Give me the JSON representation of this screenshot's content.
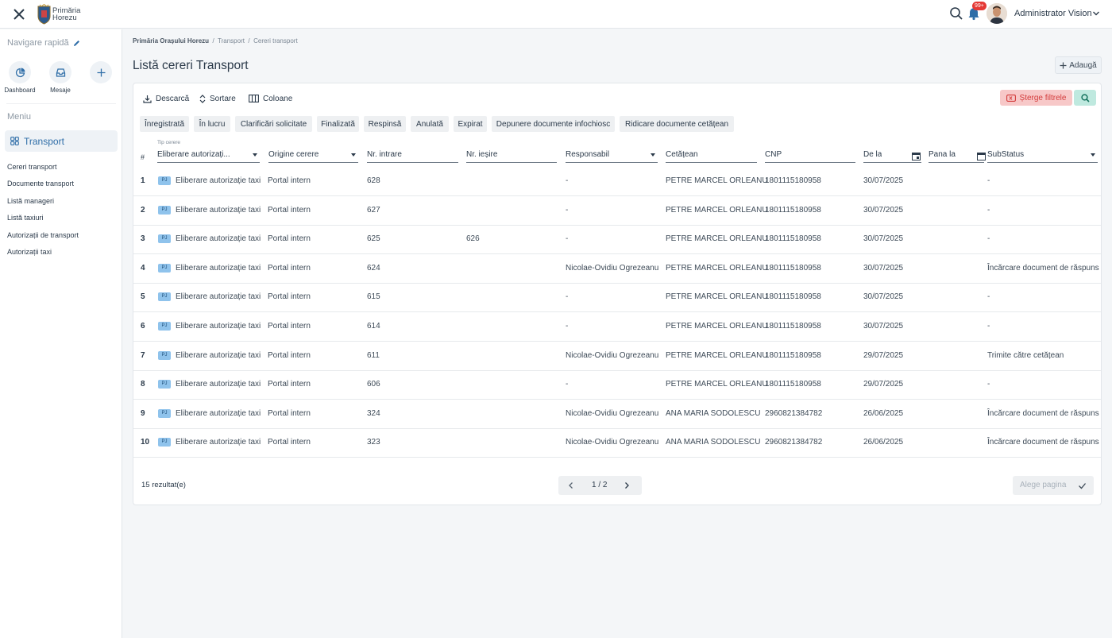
{
  "header": {
    "logo_text_line1": "Primăria",
    "logo_text_line2": "Horezu",
    "notification_badge": "99+",
    "user_name": "Administrator Vision"
  },
  "sidebar": {
    "quick_nav_title": "Navigare rapidă",
    "quick_items": [
      {
        "label": "Dashboard",
        "icon": "pie-chart-icon"
      },
      {
        "label": "Mesaje",
        "icon": "inbox-icon"
      },
      {
        "label": "",
        "icon": "plus-icon"
      }
    ],
    "menu_title": "Meniu",
    "active_item": "Transport",
    "sub_items": [
      "Cereri transport",
      "Documente transport",
      "Listă manageri",
      "Listă taxiuri",
      "Autorizații de transport",
      "Autorizații taxi"
    ]
  },
  "breadcrumb": {
    "root": "Primăria Orașului Horezu",
    "section": "Transport",
    "current": "Cereri transport"
  },
  "page": {
    "title": "Listă cereri Transport",
    "add_label": "Adaugă"
  },
  "toolbar": {
    "download": "Descarcă",
    "sort": "Sortare",
    "columns": "Coloane",
    "clear_filters": "Șterge filtrele"
  },
  "status_chips": [
    "Înregistrată",
    "În lucru",
    "Clarificări solicitate",
    "Finalizată",
    "Respinsă",
    "Anulată",
    "Expirat",
    "Depunere documente infochiosc",
    "Ridicare documente cetățean"
  ],
  "filters": {
    "hash": "#",
    "tip_cerere_small": "Tip cerere",
    "tip_cerere": "Eliberare autorizați...",
    "origine": "Origine cerere",
    "nr_intrare": "Nr. intrare",
    "nr_iesire": "Nr. ieșire",
    "responsabil": "Responsabil",
    "cetatean": "Cetățean",
    "cnp": "CNP",
    "de_la": "De la",
    "pana_la": "Pana la",
    "substatus": "SubStatus"
  },
  "rows": [
    {
      "num": "1",
      "badge": "PJ",
      "tip": "Eliberare autorizație taxi",
      "origine": "Portal intern",
      "intrare": "628",
      "iesire": "",
      "responsabil": "-",
      "cetatean": "PETRE MARCEL ORLEANU",
      "cnp": "1801115180958",
      "data": "30/07/2025",
      "substatus": "-"
    },
    {
      "num": "2",
      "badge": "PJ",
      "tip": "Eliberare autorizație taxi",
      "origine": "Portal intern",
      "intrare": "627",
      "iesire": "",
      "responsabil": "-",
      "cetatean": "PETRE MARCEL ORLEANU",
      "cnp": "1801115180958",
      "data": "30/07/2025",
      "substatus": "-"
    },
    {
      "num": "3",
      "badge": "PJ",
      "tip": "Eliberare autorizație taxi",
      "origine": "Portal intern",
      "intrare": "625",
      "iesire": "626",
      "responsabil": "-",
      "cetatean": "PETRE MARCEL ORLEANU",
      "cnp": "1801115180958",
      "data": "30/07/2025",
      "substatus": "-"
    },
    {
      "num": "4",
      "badge": "PJ",
      "tip": "Eliberare autorizație taxi",
      "origine": "Portal intern",
      "intrare": "624",
      "iesire": "",
      "responsabil": "Nicolae-Ovidiu Ogrezeanu",
      "cetatean": "PETRE MARCEL ORLEANU",
      "cnp": "1801115180958",
      "data": "30/07/2025",
      "substatus": "Încărcare document de răspuns"
    },
    {
      "num": "5",
      "badge": "PJ",
      "tip": "Eliberare autorizație taxi",
      "origine": "Portal intern",
      "intrare": "615",
      "iesire": "",
      "responsabil": "-",
      "cetatean": "PETRE MARCEL ORLEANU",
      "cnp": "1801115180958",
      "data": "30/07/2025",
      "substatus": "-"
    },
    {
      "num": "6",
      "badge": "PJ",
      "tip": "Eliberare autorizație taxi",
      "origine": "Portal intern",
      "intrare": "614",
      "iesire": "",
      "responsabil": "-",
      "cetatean": "PETRE MARCEL ORLEANU",
      "cnp": "1801115180958",
      "data": "30/07/2025",
      "substatus": "-"
    },
    {
      "num": "7",
      "badge": "PJ",
      "tip": "Eliberare autorizație taxi",
      "origine": "Portal intern",
      "intrare": "611",
      "iesire": "",
      "responsabil": "Nicolae-Ovidiu Ogrezeanu",
      "cetatean": "PETRE MARCEL ORLEANU",
      "cnp": "1801115180958",
      "data": "29/07/2025",
      "substatus": "Trimite către cetățean"
    },
    {
      "num": "8",
      "badge": "PJ",
      "tip": "Eliberare autorizație taxi",
      "origine": "Portal intern",
      "intrare": "606",
      "iesire": "",
      "responsabil": "-",
      "cetatean": "PETRE MARCEL ORLEANU",
      "cnp": "1801115180958",
      "data": "29/07/2025",
      "substatus": "-"
    },
    {
      "num": "9",
      "badge": "PJ",
      "tip": "Eliberare autorizație taxi",
      "origine": "Portal intern",
      "intrare": "324",
      "iesire": "",
      "responsabil": "Nicolae-Ovidiu Ogrezeanu",
      "cetatean": "ANA MARIA SODOLESCU",
      "cnp": "2960821384782",
      "data": "26/06/2025",
      "substatus": "Încărcare document de răspuns"
    },
    {
      "num": "10",
      "badge": "PJ",
      "tip": "Eliberare autorizație taxi",
      "origine": "Portal intern",
      "intrare": "323",
      "iesire": "",
      "responsabil": "Nicolae-Ovidiu Ogrezeanu",
      "cetatean": "ANA MARIA SODOLESCU",
      "cnp": "2960821384782",
      "data": "26/06/2025",
      "substatus": "Încărcare document de răspuns"
    }
  ],
  "footer": {
    "results": "15 rezultat(e)",
    "page": "1 / 2",
    "page_picker_placeholder": "Alege pagina"
  },
  "colors": {
    "accent": "#2f6ea8",
    "danger_bg": "#f7c8c8",
    "danger_text": "#d33b3b",
    "search_bg": "#bfe9df",
    "badge_bg": "#8fc3ec"
  }
}
